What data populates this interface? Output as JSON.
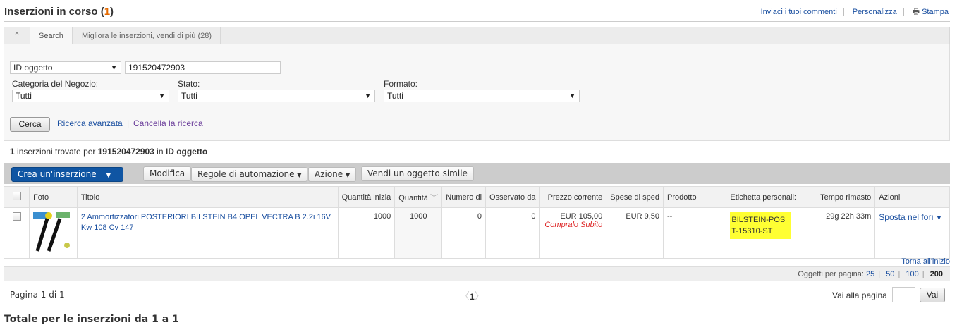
{
  "header": {
    "title": "Inserzioni in corso",
    "count": "1",
    "links": [
      "Inviaci i tuoi commenti",
      "Personalizza",
      "Stampa"
    ]
  },
  "tabs": [
    {
      "label": "Search",
      "active": true
    },
    {
      "label": "Migliora le inserzioni, vendi di più (28)",
      "active": false
    }
  ],
  "search": {
    "field_select": "ID oggetto",
    "query": "191520472903",
    "category_label": "Categoria del Negozio:",
    "category_value": "Tutti",
    "status_label": "Stato:",
    "status_value": "Tutti",
    "format_label": "Formato:",
    "format_value": "Tutti",
    "search_button": "Cerca",
    "advanced_link": "Ricerca avanzata",
    "clear_link": "Cancella la ricerca"
  },
  "results": {
    "count": "1",
    "text1": " inserzioni trovate per ",
    "query": "191520472903",
    "text2": " in ",
    "field": "ID oggetto"
  },
  "toolbar": {
    "create": "Crea un'inserzione",
    "edit": "Modifica",
    "rules": "Regole di automazione",
    "action": "Azione",
    "sell_similar": "Vendi un oggetto simile"
  },
  "table": {
    "columns": [
      "Foto",
      "Titolo",
      "Quantità inizia",
      "Quantità",
      "Numero di",
      "Osservato da",
      "Prezzo corrente",
      "Spese di sped",
      "Prodotto",
      "Etichetta personali:",
      "Tempo rimasto",
      "Azioni"
    ],
    "rows": [
      {
        "title": "2 Ammortizzatori POSTERIORI BILSTEIN B4 OPEL VECTRA B 2.2i 16V Kw 108 Cv 147",
        "qty_initial": "1000",
        "qty": "1000",
        "bids": "0",
        "watchers": "0",
        "price": "EUR 105,00",
        "format": "Compralo Subito",
        "shipping": "EUR 9,50",
        "product": "--",
        "custom_label": "BILSTEIN-POST-15310-ST",
        "time_left": "29g 22h 33m",
        "action": "Sposta nel forı"
      }
    ]
  },
  "back_to_top": "Torna all'inizio",
  "per_page": {
    "label": "Oggetti per pagina:",
    "options": [
      "25",
      "50",
      "100",
      "200"
    ],
    "selected": "200"
  },
  "pagination": {
    "label": "Pagina 1 di 1",
    "current": "1",
    "goto_label": "Vai alla pagina",
    "goto_value": "",
    "go_button": "Vai"
  },
  "totals_heading": "Totale per le inserzioni da 1 a 1",
  "colors": {
    "accent": "#0f55a3",
    "highlight": "#ffff33",
    "count": "#e56a00"
  }
}
